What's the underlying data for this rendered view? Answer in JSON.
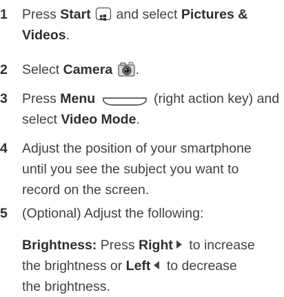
{
  "steps": [
    {
      "num": "1",
      "lines": [
        {
          "a": "Press ",
          "b": "Start",
          "c": " and select ",
          "d": "Pictures &"
        },
        {
          "b": "Videos",
          "c": "."
        }
      ]
    },
    {
      "num": "2",
      "a": "Select ",
      "b": "Camera",
      "c": "."
    },
    {
      "num": "3",
      "lines": [
        {
          "a": "Press ",
          "b": "Menu",
          "c": " (right action key) and"
        },
        {
          "a": "select ",
          "b": "Video Mode",
          "c": "."
        }
      ]
    },
    {
      "num": "4",
      "lines": [
        "Adjust the position of your smartphone",
        "until you see the subject you want to",
        "record on the screen."
      ]
    },
    {
      "num": "5",
      "text": "(Optional) Adjust the following:"
    }
  ],
  "brightness": {
    "label": "Brightness:",
    "l1a": " Press ",
    "l1b": "Right",
    "l1c": " to increase",
    "l2a": "the brightness or ",
    "l2b": "Left",
    "l2c": " to decrease",
    "l3": "the brightness."
  },
  "icons": {
    "start": "start-icon",
    "camera": "camera-icon",
    "menu": "menu-key-icon",
    "right": "right-arrow-icon",
    "left": "left-arrow-icon"
  }
}
